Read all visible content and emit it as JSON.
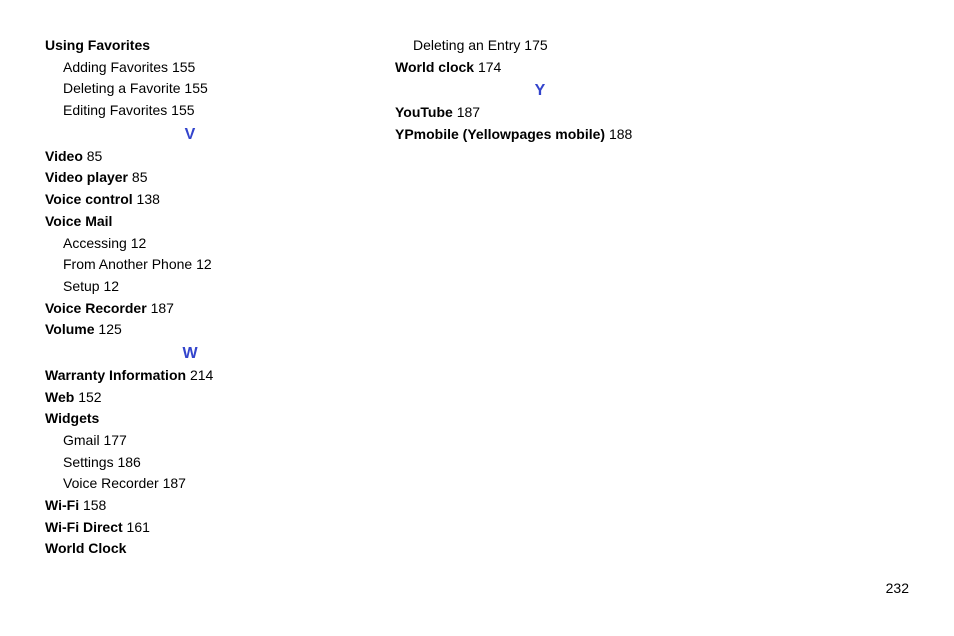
{
  "col1": {
    "using_favorites": {
      "heading": "Using Favorites",
      "sub1_label": "Adding Favorites",
      "sub1_page": "155",
      "sub2_label": "Deleting a Favorite",
      "sub2_page": "155",
      "sub3_label": "Editing Favorites",
      "sub3_page": "155"
    },
    "letter_v": "V",
    "video": {
      "term": "Video",
      "page": "85"
    },
    "video_player": {
      "term": "Video player",
      "page": "85"
    },
    "voice_control": {
      "term": "Voice control",
      "page": "138"
    },
    "voice_mail": {
      "heading": "Voice Mail",
      "sub1_label": "Accessing",
      "sub1_page": "12",
      "sub2_label": "From Another Phone",
      "sub2_page": "12",
      "sub3_label": "Setup",
      "sub3_page": "12"
    },
    "voice_recorder": {
      "term": "Voice Recorder",
      "page": "187"
    },
    "volume": {
      "term": "Volume",
      "page": "125"
    },
    "letter_w": "W",
    "warranty": {
      "term": "Warranty Information",
      "page": "214"
    },
    "web": {
      "term": "Web",
      "page": "152"
    },
    "widgets": {
      "heading": "Widgets",
      "sub1_label": "Gmail",
      "sub1_page": "177",
      "sub2_label": "Settings",
      "sub2_page": "186",
      "sub3_label": "Voice Recorder",
      "sub3_page": "187"
    },
    "wifi": {
      "term": "Wi-Fi",
      "page": "158"
    },
    "wifi_direct": {
      "term": "Wi-Fi Direct",
      "page": "161"
    },
    "world_clock_heading": "World Clock"
  },
  "col2": {
    "world_clock_sub1_label": "Deleting an Entry",
    "world_clock_sub1_page": "175",
    "world_clock2": {
      "term": "World clock",
      "page": "174"
    },
    "letter_y": "Y",
    "youtube": {
      "term": "YouTube",
      "page": "187"
    },
    "ypmobile": {
      "term": "YPmobile (Yellowpages mobile)",
      "page": "188"
    }
  },
  "page_number": "232"
}
